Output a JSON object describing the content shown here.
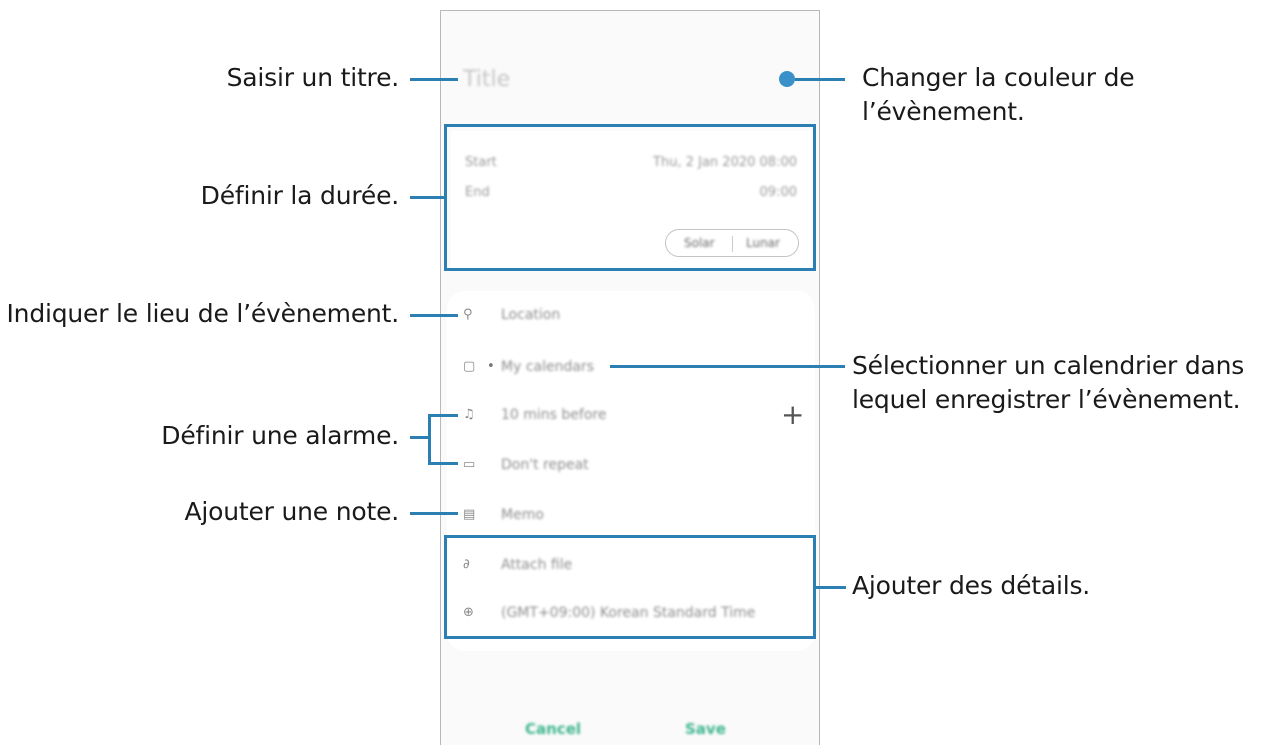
{
  "callouts": {
    "title": "Saisir un titre.",
    "color_line1": "Changer la couleur de",
    "color_line2": "l’évènement.",
    "duration": "Définir la durée.",
    "location": "Indiquer le lieu de l’évènement.",
    "calendar_line1": "Sélectionner un calendrier dans",
    "calendar_line2": "lequel enregistrer l’évènement.",
    "alarm": "Définir une alarme.",
    "note": "Ajouter une note.",
    "details": "Ajouter des détails."
  },
  "event_form": {
    "title_placeholder": "Title",
    "start_label": "Start",
    "start_value": "Thu, 2 Jan 2020  08:00",
    "end_label": "End",
    "end_value": "09:00",
    "tab_solar": "Solar",
    "tab_lunar": "Lunar",
    "location_placeholder": "Location",
    "calendar_value": "My calendars",
    "reminder_value": "10 mins before",
    "repeat_value": "Don't repeat",
    "memo_placeholder": "Memo",
    "attach_label": "Attach file",
    "timezone_value": "(GMT+09:00) Korean Standard Time",
    "add_icon": "+",
    "cancel_label": "Cancel",
    "save_label": "Save"
  },
  "colors": {
    "accent": "#2b7fb3",
    "event_color": "#3a91c9",
    "button_text": "#3fb58f"
  }
}
